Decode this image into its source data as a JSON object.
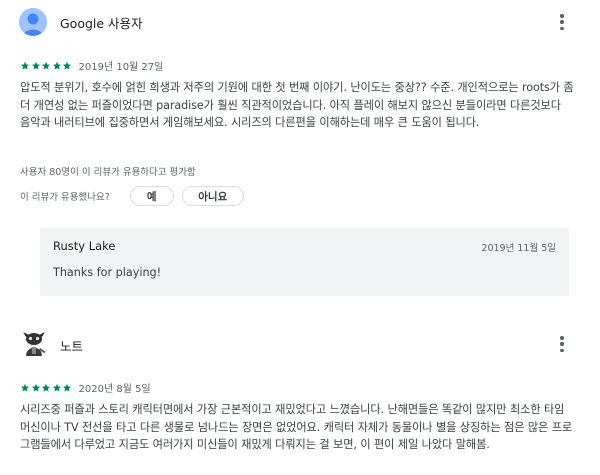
{
  "reviews": [
    {
      "author": "Google 사용자",
      "rating": 5,
      "date": "2019년 10월 27일",
      "text": "압도적 분위기, 호수에 얽힌 희생과 저주의 기원에 대한 첫 번째 이야기. 난이도는 중상?? 수준. 개인적으로는 roots가 좀 더 개연성 없는 퍼즐이었다면 paradise가 훨씬 직관적이었습니다. 아직 플레이 해보지 않으신 분들이라면 다른것보다 음악과 내러티브에 집중하면서 게임해보세요. 시리즈의 다른편을 이해하는데 매우 큰 도움이 됩니다.",
      "helpful_count_text": "사용자 80명이 이 리뷰가 유용하다고 평가함",
      "helpful_question": "이 리뷰가 유용했나요?",
      "yes_label": "예",
      "no_label": "아니요",
      "reply": {
        "author": "Rusty Lake",
        "date": "2019년 11월 5일",
        "text": "Thanks for playing!"
      }
    },
    {
      "author": "노트",
      "rating": 5,
      "date": "2020년 8월 5일",
      "text": "시리즈중 퍼즐과 스토리 캐릭터면에서 가장 근본적이고 재밌었다고 느꼈습니다. 난해면들은 똑같이 많지만 최소한 타임머신이나 TV 전선을 타고 다른 생물로 넘나드는 장면은 없었어요. 캐릭터 자체가 동물이나 별을 상징하는 점은 많은 프로그램들에서 다루었고 지금도 여러가지 미신들이 재밌게 다뤄지는 걸 보면, 이 편이 제일 나았다 말해봄."
    }
  ],
  "colors": {
    "star": "#01875f",
    "avatar_bg": "#a0c3ff",
    "avatar_fg": "#4285f4",
    "reply_bg": "#f1f3f4"
  },
  "icons": {
    "more": "more-vert-icon",
    "star": "star-icon",
    "avatar": "person-icon"
  }
}
